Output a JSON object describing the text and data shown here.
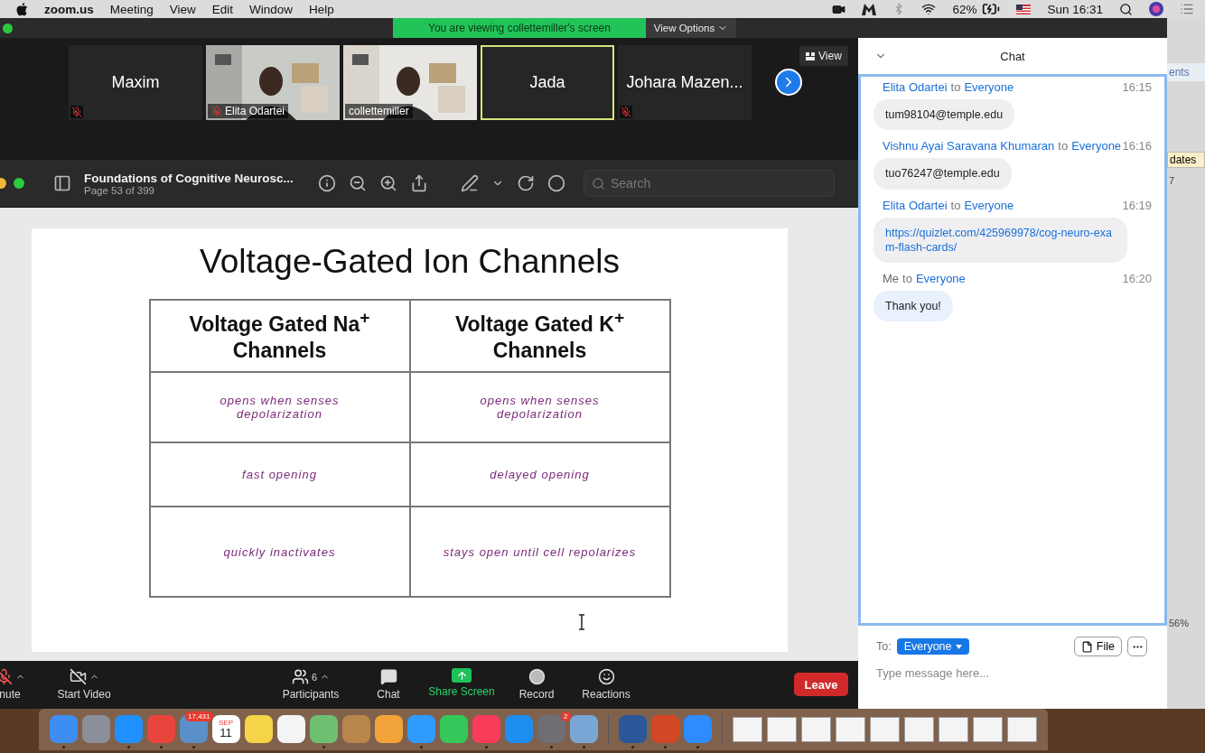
{
  "menu_bar": {
    "app": "zoom.us",
    "items": [
      "Meeting",
      "View",
      "Edit",
      "Window",
      "Help"
    ],
    "battery": "62%",
    "clock": "Sun 16:31"
  },
  "banner": {
    "text": "You are viewing collettemiller's screen",
    "options": "View Options"
  },
  "participants": [
    {
      "name": "Maxim",
      "kind": "name",
      "muted": true,
      "active": false
    },
    {
      "name": "Elita Odartei",
      "kind": "video",
      "muted": true,
      "active": false
    },
    {
      "name": "collettemiller",
      "kind": "video",
      "muted": false,
      "active": false
    },
    {
      "name": "Jada",
      "kind": "name",
      "muted": false,
      "active": true
    },
    {
      "name": "Johara Mazen...",
      "kind": "name",
      "muted": true,
      "active": false
    }
  ],
  "view_button": "View",
  "preview": {
    "title": "Foundations of Cognitive Neurosc...",
    "subtitle": "Page 53 of 399",
    "search_placeholder": "Search"
  },
  "slide": {
    "title": "Voltage-Gated Ion Channels",
    "columns": [
      "Voltage Gated Na$^{+}$ Channels",
      "Voltage Gated K$^{+}$ Channels"
    ],
    "rows": [
      [
        "opens when senses depolarization",
        "opens when senses depolarization"
      ],
      [
        "fast opening",
        "delayed opening"
      ],
      [
        "quickly inactivates",
        "stays open until cell repolarizes"
      ]
    ]
  },
  "toolbar": [
    {
      "label": "nute",
      "kind": "mic",
      "caret": true
    },
    {
      "label": "Start Video",
      "kind": "video",
      "caret": true
    },
    {
      "label": "Participants",
      "kind": "participants",
      "count": "6",
      "caret": true
    },
    {
      "label": "Chat",
      "kind": "chat",
      "caret": false
    },
    {
      "label": "Share Screen",
      "kind": "share",
      "caret": false
    },
    {
      "label": "Record",
      "kind": "record",
      "caret": false
    },
    {
      "label": "Reactions",
      "kind": "reactions",
      "caret": false
    }
  ],
  "leave": "Leave",
  "chat": {
    "title": "Chat",
    "messages": [
      {
        "sender": "Elita Odartei",
        "mine": false,
        "to": "to",
        "recipient": "Everyone",
        "time": "16:15",
        "body": "tum98104@temple.edu",
        "kind": "text"
      },
      {
        "sender": "Vishnu Ayai Saravana Khumaran",
        "mine": false,
        "to": "to",
        "recipient": "Everyone",
        "time": "16:16",
        "body": "tuo76247@temple.edu",
        "kind": "text"
      },
      {
        "sender": "Elita Odartei",
        "mine": false,
        "to": "to",
        "recipient": "Everyone",
        "time": "16:19",
        "body": "https://quizlet.com/425969978/cog-neuro-exam-flash-cards/",
        "kind": "link"
      },
      {
        "sender": "Me",
        "mine": true,
        "to": "to",
        "recipient": "Everyone",
        "time": "16:20",
        "body": "Thank you!",
        "kind": "text"
      }
    ],
    "to_label": "To:",
    "to_value": "Everyone",
    "file_button": "File",
    "placeholder": "Type message here..."
  },
  "background_window": {
    "tab_text": "ents",
    "button_text": "dates",
    "ruler_mark": "7",
    "zoom_level": "56%"
  },
  "dock": {
    "apps": [
      {
        "color": "#3d8ef0",
        "running": true
      },
      {
        "color": "#8a8f99",
        "running": false
      },
      {
        "color": "#1e90ff",
        "running": true
      },
      {
        "color": "#e8453c",
        "running": true
      },
      {
        "color": "#5b8fc9",
        "running": true,
        "badge": "17,431"
      },
      {
        "color": "#ffffff",
        "running": false,
        "month": "SEP",
        "day": "11"
      },
      {
        "color": "#f5d547",
        "running": false
      },
      {
        "color": "#f4f4f4",
        "running": false
      },
      {
        "color": "#6fbf73",
        "running": true
      },
      {
        "color": "#b8864b",
        "running": false
      },
      {
        "color": "#f2a33a",
        "running": false
      },
      {
        "color": "#2f9bff",
        "running": true
      },
      {
        "color": "#34c759",
        "running": false
      },
      {
        "color": "#fa3c5a",
        "running": true
      },
      {
        "color": "#1f8ef1",
        "running": false
      },
      {
        "color": "#6e6e73",
        "running": true,
        "badge": "2"
      },
      {
        "color": "#7aa6d6",
        "running": true
      },
      {
        "color": "#2b579a",
        "running": true
      },
      {
        "color": "#d24726",
        "running": true
      },
      {
        "color": "#2d8cff",
        "running": true
      }
    ],
    "windows": [
      {
        "kind": "window"
      },
      {
        "kind": "window"
      },
      {
        "kind": "window"
      },
      {
        "kind": "window"
      },
      {
        "kind": "window"
      },
      {
        "kind": "window"
      },
      {
        "kind": "window"
      },
      {
        "kind": "window"
      },
      {
        "kind": "window"
      }
    ]
  }
}
